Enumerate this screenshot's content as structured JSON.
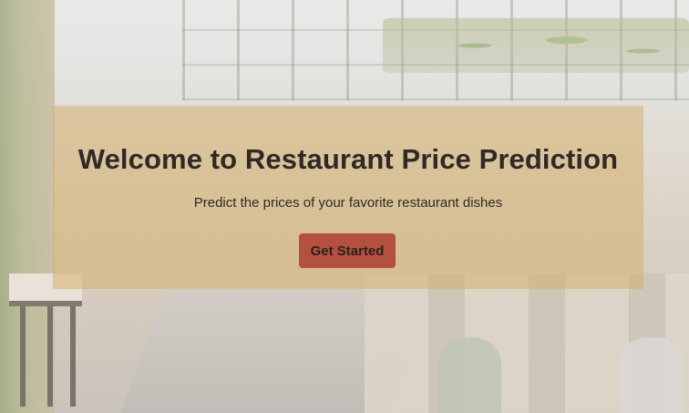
{
  "hero": {
    "title": "Welcome to Restaurant Price Prediction",
    "subtitle": "Predict the prices of your favorite restaurant dishes",
    "cta_label": "Get Started"
  },
  "colors": {
    "overlay": "#d6b06e",
    "button_bg": "#b4503f",
    "text": "#2f2a25"
  }
}
